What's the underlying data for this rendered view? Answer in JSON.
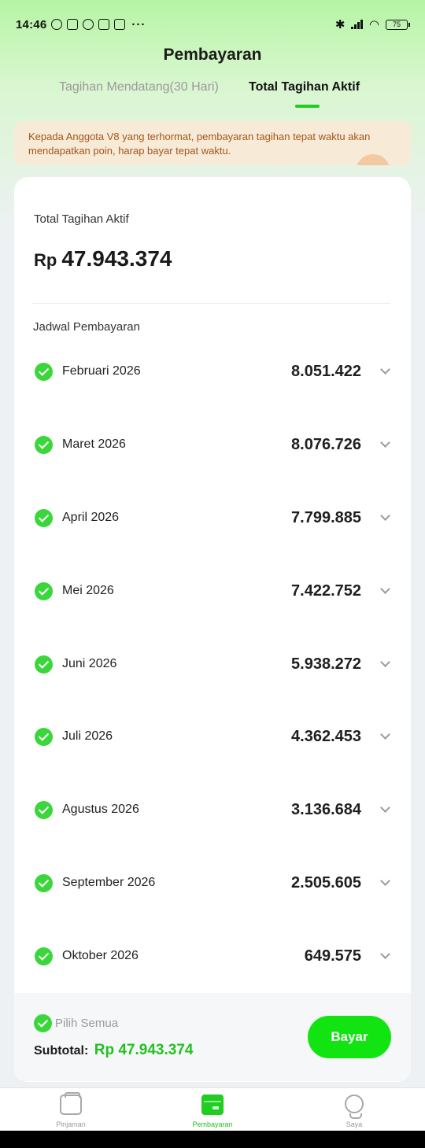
{
  "status_bar": {
    "time": "14:46",
    "dots": "···",
    "battery": "75"
  },
  "header": {
    "title": "Pembayaran"
  },
  "tabs": [
    {
      "label": "Tagihan Mendatang(30 Hari)",
      "active": false
    },
    {
      "label": "Total Tagihan Aktif",
      "active": true
    }
  ],
  "notice": {
    "text": "Kepada Anggota V8 yang terhormat, pembayaran tagihan tepat waktu akan mendapatkan poin, harap bayar tepat waktu."
  },
  "summary": {
    "label": "Total Tagihan Aktif",
    "currency": "Rp",
    "amount": "47.943.374"
  },
  "schedule": {
    "label": "Jadwal Pembayaran",
    "items": [
      {
        "month": "Februari 2026",
        "amount": "8.051.422"
      },
      {
        "month": "Maret 2026",
        "amount": "8.076.726"
      },
      {
        "month": "April 2026",
        "amount": "7.799.885"
      },
      {
        "month": "Mei 2026",
        "amount": "7.422.752"
      },
      {
        "month": "Juni 2026",
        "amount": "5.938.272"
      },
      {
        "month": "Juli 2026",
        "amount": "4.362.453"
      },
      {
        "month": "Agustus 2026",
        "amount": "3.136.684"
      },
      {
        "month": "September 2026",
        "amount": "2.505.605"
      },
      {
        "month": "Oktober 2026",
        "amount": "649.575"
      }
    ]
  },
  "footer": {
    "select_all": "Pilih Semua",
    "subtotal_label": "Subtotal:",
    "subtotal_value": "Rp 47.943.374",
    "pay_button": "Bayar"
  },
  "bottom_nav": [
    {
      "label": "Pinjaman",
      "icon": "wallet-icon"
    },
    {
      "label": "Pembayaran",
      "icon": "card-icon",
      "active": true
    },
    {
      "label": "Saya",
      "icon": "profile-icon"
    }
  ],
  "colors": {
    "accent": "#22cc22",
    "button": "#12e412",
    "notice_bg": "#f7ead7",
    "notice_text": "#a3561d"
  }
}
